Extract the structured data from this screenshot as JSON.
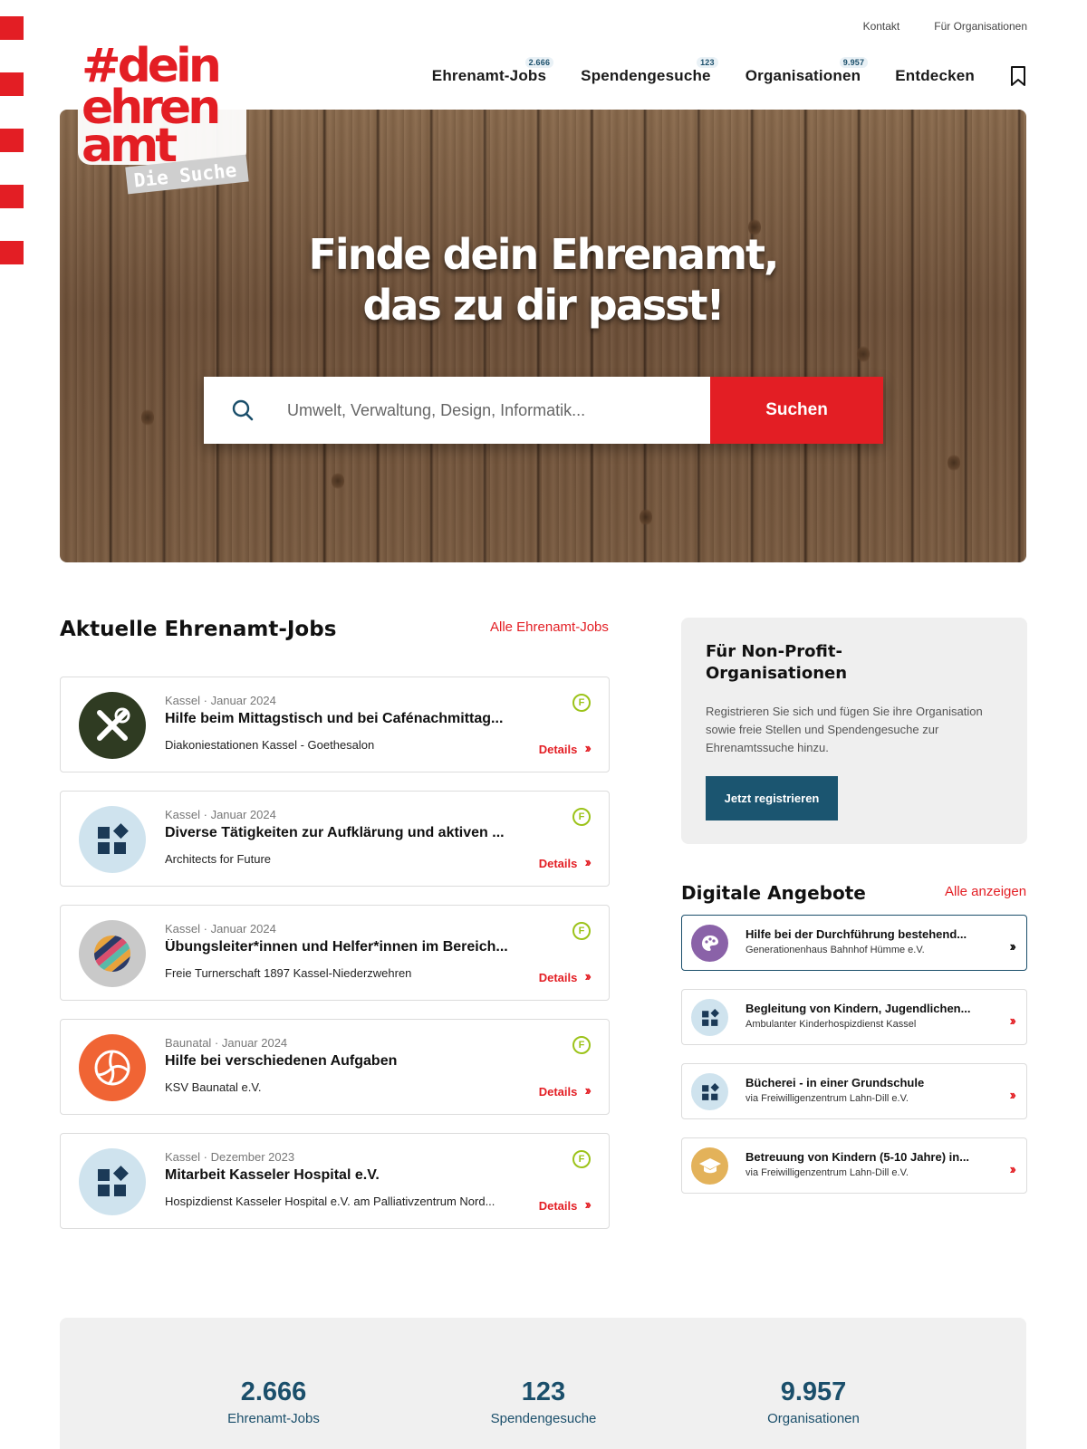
{
  "top_links": [
    "Kontakt",
    "Für Organisationen"
  ],
  "nav": [
    {
      "label": "Ehrenamt-Jobs",
      "badge": "2.666"
    },
    {
      "label": "Spendengesuche",
      "badge": "123"
    },
    {
      "label": "Organisationen",
      "badge": "9.957"
    },
    {
      "label": "Entdecken",
      "badge": null
    }
  ],
  "logo": {
    "line1": "#dein",
    "line2": "ehren",
    "line3": "amt",
    "tag": "Die Suche"
  },
  "hero": {
    "title_line1": "Finde dein Ehrenamt,",
    "title_line2": "das zu dir passt!",
    "search_placeholder": "Umwelt, Verwaltung, Design, Informatik...",
    "search_button": "Suchen"
  },
  "jobs_section": {
    "title": "Aktuelle Ehrenamt-Jobs",
    "link": "Alle Ehrenamt-Jobs"
  },
  "jobs": [
    {
      "meta": "Kassel · Januar 2024",
      "title": "Hilfe beim Mittagstisch und bei Cafénachmittag...",
      "org": "Diakoniestationen Kassel - Goethesalon",
      "details": "Details",
      "icon": "tools-icon",
      "badge": "F"
    },
    {
      "meta": "Kassel · Januar 2024",
      "title": "Diverse Tätigkeiten zur Aufklärung und aktiven ...",
      "org": "Architects for Future",
      "details": "Details",
      "icon": "blocks-icon",
      "badge": "F"
    },
    {
      "meta": "Kassel · Januar 2024",
      "title": "Übungsleiter*innen und Helfer*innen im Bereich...",
      "org": "Freie Turnerschaft 1897 Kassel-Niederzwehren",
      "details": "Details",
      "icon": "stripes-icon",
      "badge": "F"
    },
    {
      "meta": "Baunatal · Januar 2024",
      "title": "Hilfe bei verschiedenen Aufgaben",
      "org": "KSV Baunatal e.V.",
      "details": "Details",
      "icon": "volleyball-icon",
      "badge": "F"
    },
    {
      "meta": "Kassel · Dezember 2023",
      "title": "Mitarbeit Kasseler Hospital e.V.",
      "org": "Hospizdienst Kasseler Hospital e.V. am Palliativzentrum Nord...",
      "details": "Details",
      "icon": "blocks-icon",
      "badge": "F"
    }
  ],
  "npo": {
    "title": "Für Non-Profit-Organisationen",
    "title_line1": "Für Non-Profit-",
    "title_line2": "Organisationen",
    "text": "Registrieren Sie sich und fügen Sie ihre Organisation sowie freie Stellen und Spendengesuche zur Ehrenamtssuche hinzu.",
    "button": "Jetzt registrieren"
  },
  "digital_section": {
    "title": "Digitale Angebote",
    "link": "Alle anzeigen"
  },
  "digital": [
    {
      "title": "Hilfe bei der Durchführung bestehend...",
      "org": "Generationenhaus Bahnhof Hümme e.V.",
      "icon": "palette-icon"
    },
    {
      "title": "Begleitung von Kindern, Jugendlichen...",
      "org": "Ambulanter Kinderhospizdienst Kassel",
      "icon": "blocks-icon"
    },
    {
      "title": "Bücherei - in einer Grundschule",
      "org": "via Freiwilligenzentrum Lahn-Dill e.V.",
      "icon": "blocks-icon"
    },
    {
      "title": "Betreuung von Kindern (5-10 Jahre) in...",
      "org": "via Freiwilligenzentrum Lahn-Dill e.V.",
      "icon": "graduation-cap-icon"
    }
  ],
  "stats": [
    {
      "value": "2.666",
      "label": "Ehrenamt-Jobs"
    },
    {
      "value": "123",
      "label": "Spendengesuche"
    },
    {
      "value": "9.957",
      "label": "Organisationen"
    }
  ],
  "colors": {
    "brand_red": "#e31e24",
    "brand_blue": "#1b4f6b",
    "freiwillig_green": "#9cc31a"
  }
}
